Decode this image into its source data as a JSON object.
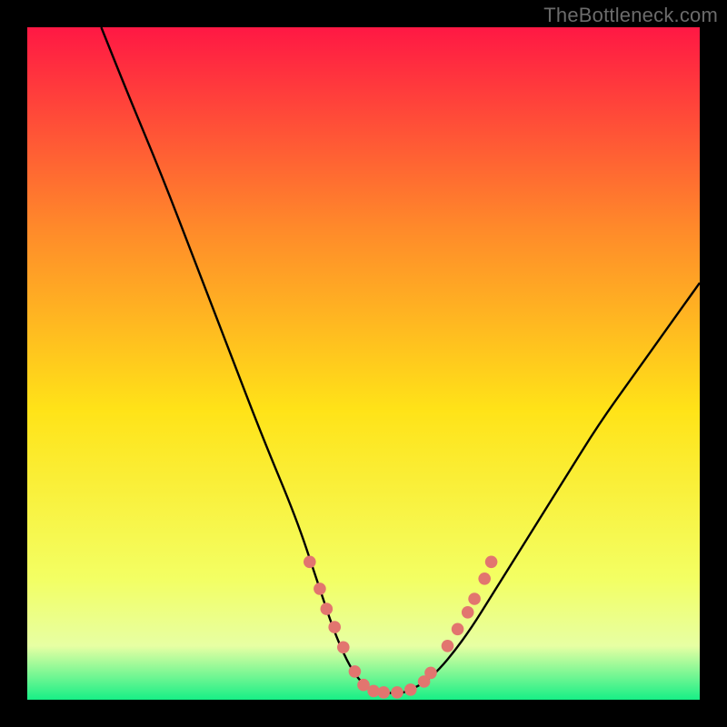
{
  "watermark": "TheBottleneck.com",
  "chart_data": {
    "type": "line",
    "title": "",
    "xlabel": "",
    "ylabel": "",
    "xlim": [
      0,
      100
    ],
    "ylim": [
      0,
      100
    ],
    "grid": false,
    "legend": false,
    "background_gradient": {
      "top": "#ff1844",
      "upper_mid": "#ff8a2a",
      "mid": "#ffe318",
      "lower_mid": "#f3ff63",
      "bottom": "#17ef86"
    },
    "curve": {
      "description": "V-shaped bottleneck curve; steep descent on the left falling into a flat minimum then rising to the right",
      "x": [
        11,
        15,
        20,
        25,
        30,
        35,
        40,
        43,
        46,
        49,
        52,
        55,
        56,
        60,
        65,
        70,
        75,
        80,
        85,
        90,
        95,
        100
      ],
      "y": [
        100,
        90,
        78,
        65,
        52,
        39,
        27,
        18,
        9,
        3,
        1,
        1,
        1,
        3,
        9,
        17,
        25,
        33,
        41,
        48,
        55,
        62
      ]
    },
    "markers": {
      "description": "Pink dashed-dot markers along the lower portion of the curve near the minimum",
      "color": "#e2756f",
      "x": [
        42.0,
        43.5,
        44.5,
        45.7,
        47.0,
        48.7,
        50.0,
        51.5,
        53.0,
        55.0,
        57.0,
        59.0,
        60.0,
        62.5,
        64.0,
        65.5,
        66.5,
        68.0,
        69.0
      ],
      "y": [
        20.5,
        16.5,
        13.5,
        10.8,
        7.8,
        4.2,
        2.2,
        1.3,
        1.1,
        1.1,
        1.5,
        2.7,
        4.0,
        8.0,
        10.5,
        13.0,
        15.0,
        18.0,
        20.5
      ]
    }
  }
}
